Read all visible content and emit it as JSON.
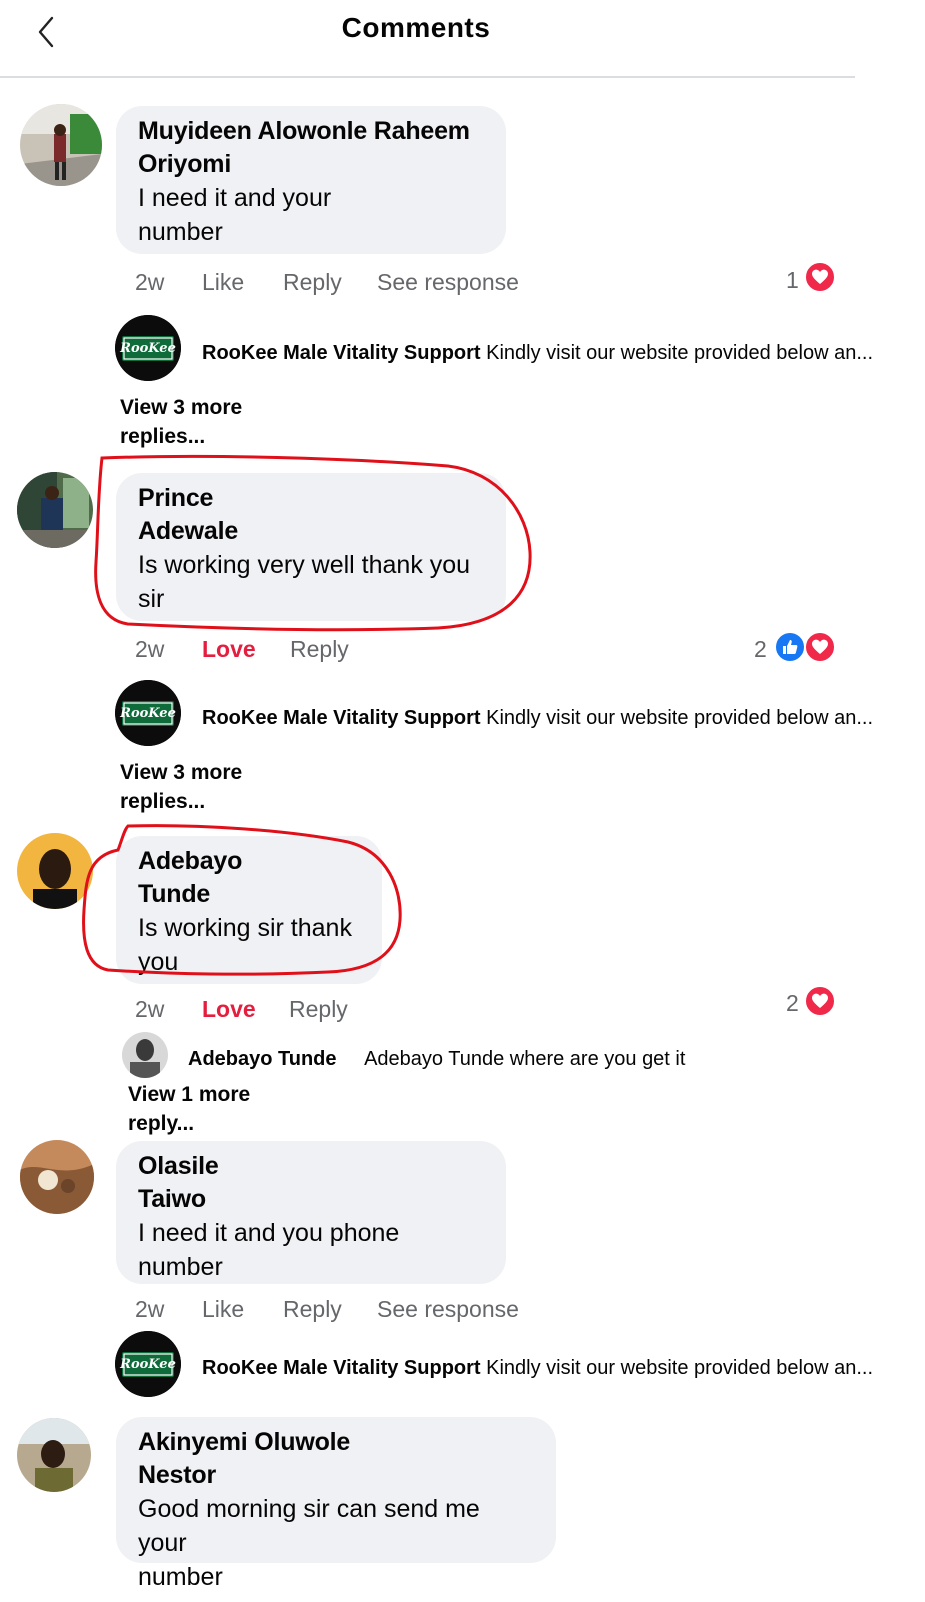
{
  "header": {
    "title": "Comments"
  },
  "comments": [
    {
      "author_line1": "Muyideen Alowonle Raheem",
      "author_line2": "Oriyomi",
      "text_line1": "I need it and your",
      "text_line2": "number",
      "time": "2w",
      "like_label": "Like",
      "reply_label": "Reply",
      "see_response_label": "See response",
      "reaction_count": "1",
      "reply": {
        "author": "RooKee Male Vitality Support",
        "text": "Kindly visit our website provided below an..."
      },
      "view_more": {
        "line1": "View 3 more",
        "line2": "replies..."
      }
    },
    {
      "author_line1": "Prince",
      "author_line2": "Adewale",
      "text_line1": "Is working very well thank you",
      "text_line2": "sir",
      "time": "2w",
      "like_label": "Love",
      "reply_label": "Reply",
      "reaction_count": "2",
      "reply": {
        "author": "RooKee Male Vitality Support",
        "text": "Kindly visit our website provided below an..."
      },
      "view_more": {
        "line1": "View 3 more",
        "line2": "replies..."
      }
    },
    {
      "author_line1": "Adebayo",
      "author_line2": "Tunde",
      "text_line1": "Is working sir thank",
      "text_line2": "you",
      "time": "2w",
      "like_label": "Love",
      "reply_label": "Reply",
      "reaction_count": "2",
      "reply": {
        "author": "Adebayo Tunde",
        "text": "Adebayo Tunde where are you get it"
      },
      "view_more": {
        "line1": "View 1 more",
        "line2": "reply..."
      }
    },
    {
      "author_line1": "Olasile",
      "author_line2": "Taiwo",
      "text_line1": "I need it and you phone",
      "text_line2": "number",
      "time": "2w",
      "like_label": "Like",
      "reply_label": "Reply",
      "see_response_label": "See response",
      "reply": {
        "author": "RooKee Male Vitality Support",
        "text": "Kindly visit our website provided below an..."
      }
    },
    {
      "author_line1": "Akinyemi Oluwole",
      "author_line2": "Nestor",
      "text_line1": "Good morning sir can send me your",
      "text_line2": "number"
    }
  ],
  "page_logo_text": "RooKee",
  "colors": {
    "love": "#e41e3f",
    "heart": "#f0284a",
    "like": "#1877f2",
    "bubble": "#f0f1f4",
    "annotation": "#e0101a"
  },
  "icons": [
    "back-chevron-icon",
    "heart-reaction-icon",
    "like-reaction-icon"
  ]
}
